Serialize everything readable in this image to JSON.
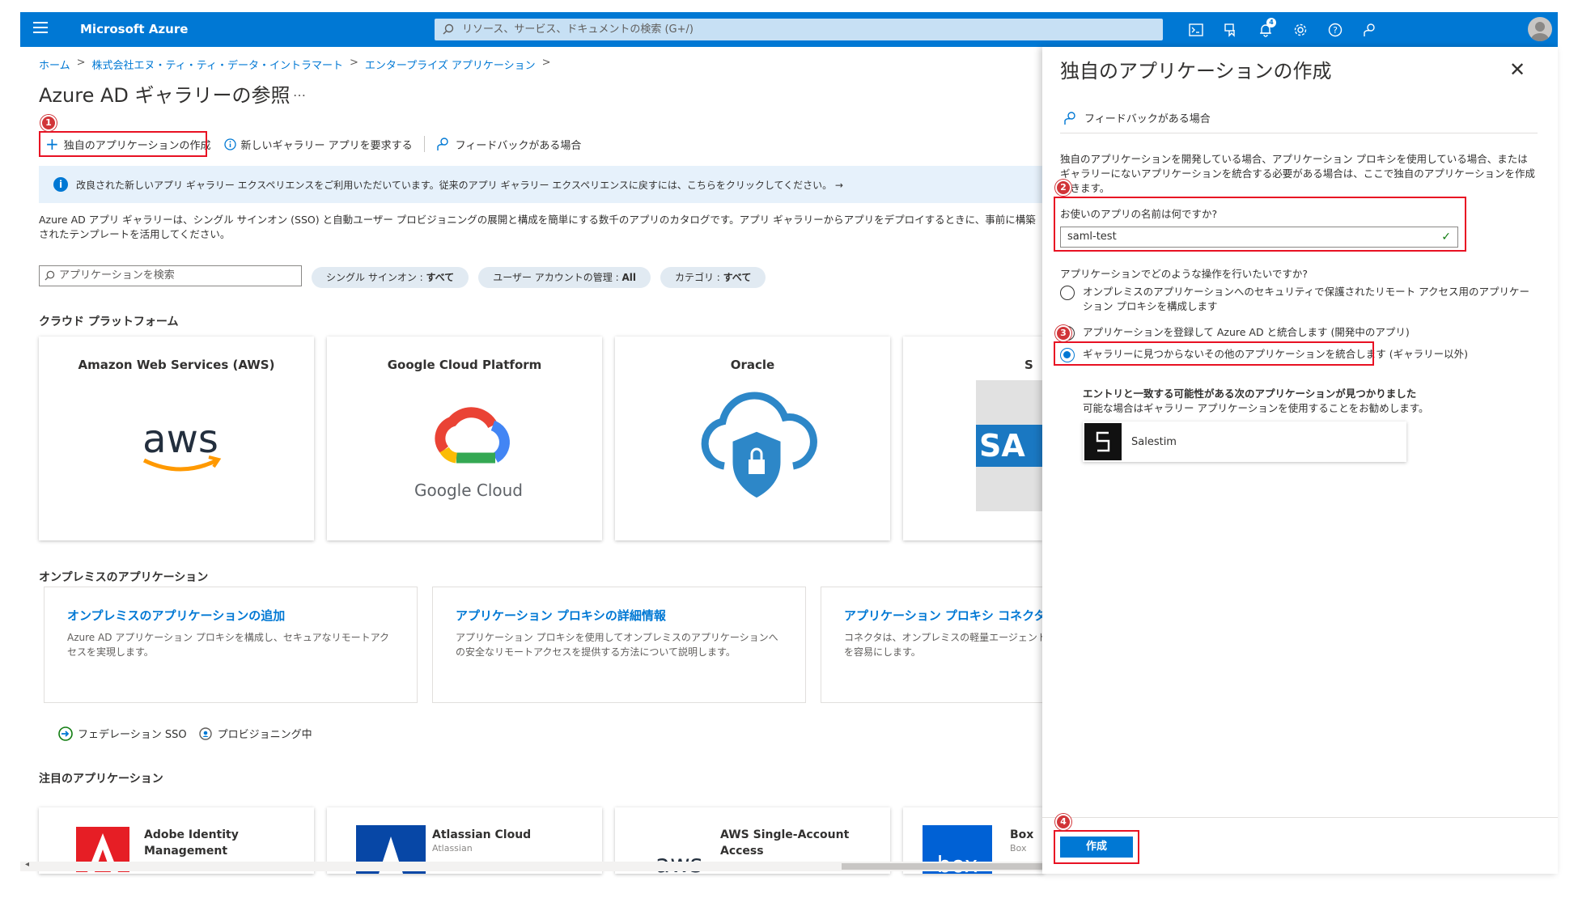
{
  "topbar": {
    "brand": "Microsoft Azure",
    "search_placeholder": "リソース、サービス、ドキュメントの検索 (G+/)",
    "notification_count": "4",
    "icons": [
      "cloud-shell-icon",
      "directory-filter-icon",
      "notifications-icon",
      "settings-icon",
      "help-icon",
      "feedback-icon"
    ],
    "accent": "#0078d4"
  },
  "breadcrumb": [
    "ホーム",
    "株式会社エヌ・ティ・ティ・データ・イントラマート",
    "エンタープライズ アプリケーション"
  ],
  "page": {
    "title": "Azure AD ギャラリーの参照",
    "more": "…"
  },
  "toolbar": {
    "create_own": "独自のアプリケーションの作成",
    "request_app": "新しいギャラリー アプリを要求する",
    "feedback": "フィードバックがある場合"
  },
  "info_bar": "改良された新しいアプリ ギャラリー エクスペリエンスをご利用いただいています。従来のアプリ ギャラリー エクスペリエンスに戻すには、こちらをクリックしてください。 →",
  "description": "Azure AD アプリ ギャラリーは、シングル サインオン (SSO) と自動ユーザー プロビジョニングの展開と構成を簡単にする数千のアプリのカタログです。アプリ ギャラリーからアプリをデプロイするときに、事前に構築されたテンプレートを活用してください。",
  "filters": {
    "search_placeholder": "アプリケーションを検索",
    "pills": [
      {
        "label": "シングル サインオン : ",
        "value": "すべて"
      },
      {
        "label": "ユーザー アカウントの管理 : ",
        "value": "All"
      },
      {
        "label": "カテゴリ : ",
        "value": "すべて"
      }
    ]
  },
  "cloud_section": {
    "heading": "クラウド プラットフォーム",
    "cards": [
      {
        "title": "Amazon Web Services (AWS)",
        "logo_text": "aws"
      },
      {
        "title": "Google Cloud Platform",
        "logo_text": "Google Cloud"
      },
      {
        "title": "Oracle"
      },
      {
        "title": "S",
        "logo_text": "SA"
      }
    ]
  },
  "onprem_section": {
    "heading": "オンプレミスのアプリケーション",
    "cards": [
      {
        "title": "オンプレミスのアプリケーションの追加",
        "desc": "Azure AD アプリケーション プロキシを構成し、セキュアなリモートアクセスを実現します。"
      },
      {
        "title": "アプリケーション プロキシの詳細情報",
        "desc": "アプリケーション プロキシを使用してオンプレミスのアプリケーションへの安全なリモートアクセスを提供する方法について説明します。"
      },
      {
        "title": "アプリケーション プロキシ コネクタの管理",
        "desc": "コネクタは、オンプレミスの軽量エージェントであり、サービスへの送信接続を容易にします。"
      }
    ]
  },
  "legend": {
    "federation": "フェデレーション SSO",
    "provisioning": "プロビジョニング中"
  },
  "featured_section": {
    "heading": "注目のアプリケーション",
    "cards": [
      {
        "name": "Adobe Identity Management",
        "publisher": ""
      },
      {
        "name": "Atlassian Cloud",
        "publisher": "Atlassian"
      },
      {
        "name": "AWS Single-Account Access",
        "publisher": "",
        "logo_text": "aws"
      },
      {
        "name": "Box",
        "publisher": "Box",
        "logo_text": "box"
      }
    ]
  },
  "panel": {
    "title": "独自のアプリケーションの作成",
    "close": "✕",
    "feedback": "フィードバックがある場合",
    "description": "独自のアプリケーションを開発している場合、アプリケーション プロキシを使用している場合、またはギャラリーにないアプリケーションを統合する必要がある場合は、ここで独自のアプリケーションを作成できます。",
    "name_label": "お使いのアプリの名前は何ですか?",
    "name_value": "saml-test",
    "question": "アプリケーションでどのような操作を行いたいですか?",
    "options": [
      {
        "label": "オンプレミスのアプリケーションへのセキュリティで保護されたリモート アクセス用のアプリケーション プロキシを構成します",
        "selected": false
      },
      {
        "label": "アプリケーションを登録して Azure AD と統合します (開発中のアプリ)",
        "selected": false
      },
      {
        "label": "ギャラリーに見つからないその他のアプリケーションを統合します (ギャラリー以外)",
        "selected": true
      }
    ],
    "match_heading": "エントリと一致する可能性がある次のアプリケーションが見つかりました",
    "match_sub": "可能な場合はギャラリー アプリケーションを使用することをお勧めします。",
    "match_app": "Salestim",
    "create_button": "作成"
  },
  "steps": [
    "1",
    "2",
    "3",
    "4"
  ],
  "highlight_color": "#e81123"
}
